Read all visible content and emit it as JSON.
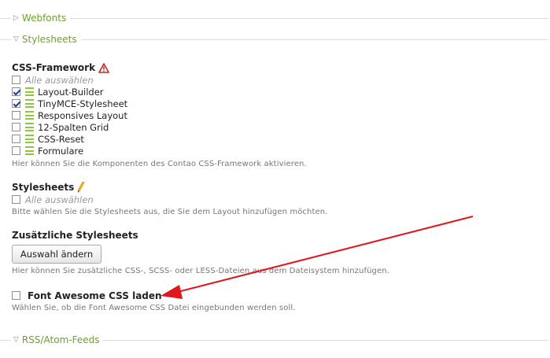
{
  "sections": {
    "webfonts": {
      "label": "Webfonts",
      "icon": "triangle-right-icon",
      "glyph": "▷"
    },
    "stylesheets": {
      "label": "Stylesheets",
      "icon": "triangle-down-icon",
      "glyph": "▽"
    },
    "rss": {
      "label": "RSS/Atom-Feeds",
      "icon": "triangle-down-icon",
      "glyph": "▽"
    }
  },
  "css_framework": {
    "heading": "CSS-Framework",
    "select_all": "Alle auswählen",
    "options": [
      {
        "label": "Layout-Builder",
        "checked": true
      },
      {
        "label": "TinyMCE-Stylesheet",
        "checked": true
      },
      {
        "label": "Responsives Layout",
        "checked": false
      },
      {
        "label": "12-Spalten Grid",
        "checked": false
      },
      {
        "label": "CSS-Reset",
        "checked": false
      },
      {
        "label": "Formulare",
        "checked": false
      }
    ],
    "help": "Hier können Sie die Komponenten des Contao CSS-Framework aktivieren."
  },
  "stylesheets_field": {
    "heading": "Stylesheets",
    "select_all": "Alle auswählen",
    "help": "Bitte wählen Sie die Stylesheets aus, die Sie dem Layout hinzufügen möchten."
  },
  "extra_stylesheets": {
    "heading": "Zusätzliche Stylesheets",
    "button": "Auswahl ändern",
    "help": "Hier können Sie zusätzliche CSS-, SCSS- oder LESS-Dateien aus dem Dateisystem hinzufügen."
  },
  "font_awesome": {
    "label": "Font Awesome CSS laden",
    "checked": false,
    "help": "Wählen Sie, ob die Font Awesome CSS Datei eingebunden werden soll."
  },
  "annotation": {
    "color": "#e0171c"
  }
}
